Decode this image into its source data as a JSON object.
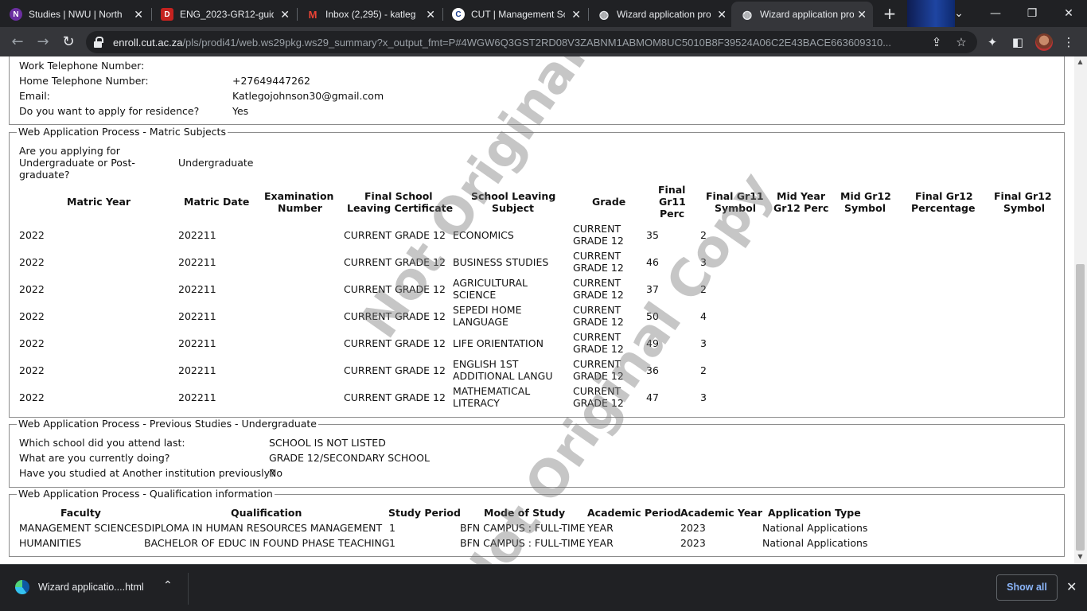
{
  "browser": {
    "tabs": [
      {
        "title": "Studies | NWU | North",
        "color": "#6b2fa0",
        "glyph": "N",
        "icon": "nwu-icon"
      },
      {
        "title": "ENG_2023-GR12-guid",
        "color": "#c5221f",
        "glyph": "D",
        "icon": "document-icon"
      },
      {
        "title": "Inbox (2,295) - katleg",
        "color": "#ea4335",
        "glyph": "M",
        "icon": "gmail-icon"
      },
      {
        "title": "CUT | Management Sc",
        "color": "#1a3d8f",
        "glyph": "C",
        "icon": "cut-icon"
      },
      {
        "title": "Wizard application pro",
        "color": "#5f6368",
        "glyph": "◍",
        "icon": "globe-icon"
      },
      {
        "title": "Wizard application pro",
        "color": "#5f6368",
        "glyph": "◍",
        "icon": "globe-icon"
      }
    ],
    "url_host": "enroll.cut.ac.za",
    "url_path": "/pls/prodi41/web.ws29pkg.ws29_summary?x_output_fmt=P#4WGW6Q3GST2RD08V3ZABNM1ABMOM8UC5010B8F39524A06C2E43BACE663609310..."
  },
  "contact": {
    "work_tel_label": "Work Telephone Number:",
    "home_tel_label": "Home Telephone Number:",
    "home_tel_value": "+27649447262",
    "email_label": "Email:",
    "email_value": "Katlegojohnson30@gmail.com",
    "residence_label": "Do you want to apply for residence?",
    "residence_value": "Yes"
  },
  "matric": {
    "legend": "Web Application Process - Matric Subjects",
    "applying_label_1": "Are you applying for",
    "applying_label_2": "Undergraduate or Post-",
    "applying_label_3": "graduate?",
    "applying_value": "Undergraduate",
    "headers": {
      "matric_year": "Matric Year",
      "matric_date": "Matric Date",
      "exam_1": "Examination",
      "exam_2": "Number",
      "fslc_1": "Final School",
      "fslc_2": "Leaving Certificate",
      "sls_1": "School Leaving",
      "sls_2": "Subject",
      "grade": "Grade",
      "gr11p_1": "Final",
      "gr11p_2": "Gr11",
      "gr11p_3": "Perc",
      "gr11s_1": "Final Gr11",
      "gr11s_2": "Symbol",
      "mygp_1": "Mid Year",
      "mygp_2": "Gr12 Perc",
      "mygs_1": "Mid Gr12",
      "mygs_2": "Symbol",
      "fg12p_1": "Final Gr12",
      "fg12p_2": "Percentage",
      "fg12s_1": "Final Gr12",
      "fg12s_2": "Symbol"
    },
    "rows": [
      {
        "year": "2022",
        "date": "202211",
        "cert": "CURRENT GRADE 12",
        "subj1": "ECONOMICS",
        "subj2": "",
        "grade1": "CURRENT",
        "grade2": "GRADE 12",
        "perc": "35",
        "sym": "2"
      },
      {
        "year": "2022",
        "date": "202211",
        "cert": "CURRENT GRADE 12",
        "subj1": "BUSINESS STUDIES",
        "subj2": "",
        "grade1": "CURRENT",
        "grade2": "GRADE 12",
        "perc": "46",
        "sym": "3"
      },
      {
        "year": "2022",
        "date": "202211",
        "cert": "CURRENT GRADE 12",
        "subj1": "AGRICULTURAL",
        "subj2": "SCIENCE",
        "grade1": "CURRENT",
        "grade2": "GRADE 12",
        "perc": "37",
        "sym": "2"
      },
      {
        "year": "2022",
        "date": "202211",
        "cert": "CURRENT GRADE 12",
        "subj1": "SEPEDI HOME",
        "subj2": "LANGUAGE",
        "grade1": "CURRENT",
        "grade2": "GRADE 12",
        "perc": "50",
        "sym": "4"
      },
      {
        "year": "2022",
        "date": "202211",
        "cert": "CURRENT GRADE 12",
        "subj1": "LIFE ORIENTATION",
        "subj2": "",
        "grade1": "CURRENT",
        "grade2": "GRADE 12",
        "perc": "49",
        "sym": "3"
      },
      {
        "year": "2022",
        "date": "202211",
        "cert": "CURRENT GRADE 12",
        "subj1": "ENGLISH 1ST",
        "subj2": "ADDITIONAL LANGU",
        "grade1": "CURRENT",
        "grade2": "GRADE 12",
        "perc": "36",
        "sym": "2"
      },
      {
        "year": "2022",
        "date": "202211",
        "cert": "CURRENT GRADE 12",
        "subj1": "MATHEMATICAL",
        "subj2": "LITERACY",
        "grade1": "CURRENT",
        "grade2": "GRADE 12",
        "perc": "47",
        "sym": "3"
      }
    ]
  },
  "previous": {
    "legend": "Web Application Process - Previous Studies - Undergraduate",
    "school_label": "Which school did you attend last:",
    "school_value": "SCHOOL IS NOT LISTED",
    "doing_label": "What are you currently doing?",
    "doing_value": "GRADE 12/SECONDARY SCHOOL",
    "studied_label": "Have you studied at Another institution previously?",
    "studied_value": "No"
  },
  "qualification": {
    "legend": "Web Application Process - Qualification information",
    "headers": {
      "faculty": "Faculty",
      "qualification": "Qualification",
      "study_period": "Study Period",
      "mode": "Mode of Study",
      "acad_period": "Academic Period",
      "acad_year": "Academic Year",
      "app_type": "Application Type"
    },
    "rows": [
      {
        "faculty": "MANAGEMENT SCIENCES",
        "qualification": "DIPLOMA IN HUMAN RESOURCES MANAGEMENT",
        "study_period": "1",
        "mode": "BFN CAMPUS : FULL-TIME",
        "acad_period": "YEAR",
        "acad_year": "2023",
        "app_type": "National Applications"
      },
      {
        "faculty": "HUMANITIES",
        "qualification": "BACHELOR OF EDUC IN FOUND PHASE TEACHING",
        "study_period": "1",
        "mode": "BFN CAMPUS : FULL-TIME",
        "acad_period": "YEAR",
        "acad_year": "2023",
        "app_type": "National Applications"
      }
    ]
  },
  "watermark": {
    "text_1": "Not Original Copy",
    "text_2": "Not Original Copy"
  },
  "downloads": {
    "file_name": "Wizard applicatio....html",
    "show_all": "Show all"
  }
}
